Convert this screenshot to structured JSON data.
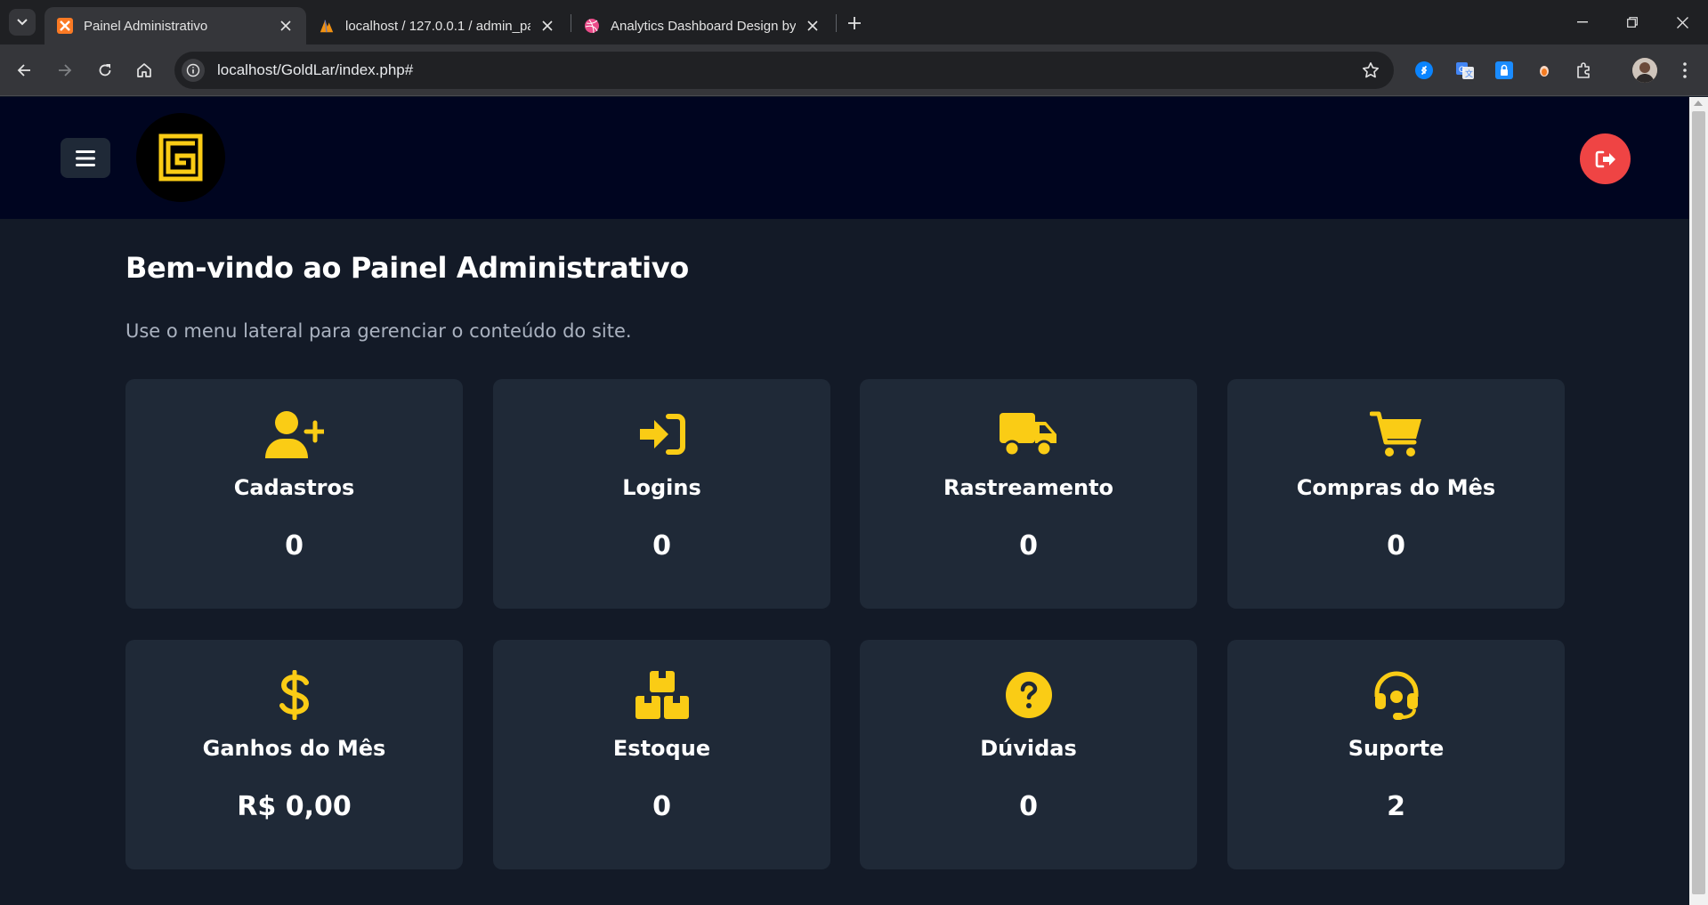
{
  "browser": {
    "tabs": [
      {
        "title": "Painel Administrativo",
        "active": true
      },
      {
        "title": "localhost / 127.0.0.1 / admin_pa",
        "active": false
      },
      {
        "title": "Analytics Dashboard Design by",
        "active": false
      }
    ],
    "url": "localhost/GoldLar/index.php#"
  },
  "colors": {
    "accent": "#facc15",
    "logout": "#ef4444",
    "header_bg": "#000520",
    "page_bg": "#131a27",
    "card_bg": "#1f2937"
  },
  "header": {
    "menu_icon": "hamburger-icon",
    "logo_icon": "goldlar-logo",
    "logout_icon": "logout-icon"
  },
  "main": {
    "title": "Bem-vindo ao Painel Administrativo",
    "subtitle": "Use o menu lateral para gerenciar o conteúdo do site.",
    "cards": [
      {
        "label": "Cadastros",
        "value": "0",
        "icon": "user-plus-icon"
      },
      {
        "label": "Logins",
        "value": "0",
        "icon": "sign-in-icon"
      },
      {
        "label": "Rastreamento",
        "value": "0",
        "icon": "truck-icon"
      },
      {
        "label": "Compras do Mês",
        "value": "0",
        "icon": "cart-icon"
      },
      {
        "label": "Ganhos do Mês",
        "value": "R$ 0,00",
        "icon": "dollar-icon"
      },
      {
        "label": "Estoque",
        "value": "0",
        "icon": "boxes-icon"
      },
      {
        "label": "Dúvidas",
        "value": "0",
        "icon": "question-circle-icon"
      },
      {
        "label": "Suporte",
        "value": "2",
        "icon": "headset-icon"
      }
    ]
  }
}
